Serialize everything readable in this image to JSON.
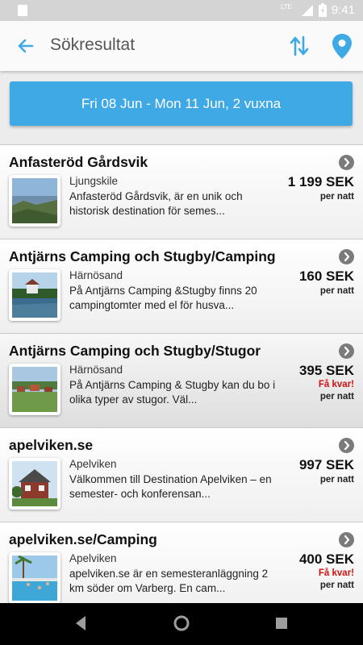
{
  "status_bar": {
    "network": "LTE",
    "time": "9:41"
  },
  "app_bar": {
    "title": "Sökresultat"
  },
  "date_filter": {
    "label": "Fri 08 Jun - Mon 11 Jun, 2 vuxna"
  },
  "results": [
    {
      "name": "Anfasteröd Gårdsvik",
      "location": "Ljungskile",
      "description": "Anfasteröd Gårdsvik, är en unik och historisk destination för semes...",
      "price": "1 199 SEK",
      "few_left": "",
      "per_night": "per natt"
    },
    {
      "name": "Antjärns Camping och Stugby/Camping",
      "location": "Härnösand",
      "description": "På Antjärns Camping &Stugby finns 20 campingtomter med el för husva...",
      "price": "160 SEK",
      "few_left": "",
      "per_night": "per natt"
    },
    {
      "name": "Antjärns Camping och Stugby/Stugor",
      "location": "Härnösand",
      "description": "På Antjärns Camping & Stugby kan du bo i olika typer av stugor. Väl...",
      "price": "395 SEK",
      "few_left": "Få kvar!",
      "per_night": "per natt"
    },
    {
      "name": "apelviken.se",
      "location": "Apelviken",
      "description": "Välkommen till Destination Apelviken – en semester- och konferensan...",
      "price": "997 SEK",
      "few_left": "",
      "per_night": "per natt"
    },
    {
      "name": "apelviken.se/Camping",
      "location": "Apelviken",
      "description": "apelviken.se är en semesteranläggning 2 km söder om Varberg. En cam...",
      "price": "400 SEK",
      "few_left": "Få kvar!",
      "per_night": "per natt"
    }
  ],
  "icons": {
    "back": "arrow-back-icon",
    "sort": "sort-arrows-icon",
    "map": "map-pin-icon",
    "chevron": "chevron-right-circle-icon",
    "nav_back": "triangle-back-icon",
    "nav_home": "circle-home-icon",
    "nav_recents": "square-recents-icon"
  },
  "colors": {
    "accent": "#3fa9e6",
    "few_left": "#cc1111",
    "chevron_bg": "#7b7b7b"
  }
}
